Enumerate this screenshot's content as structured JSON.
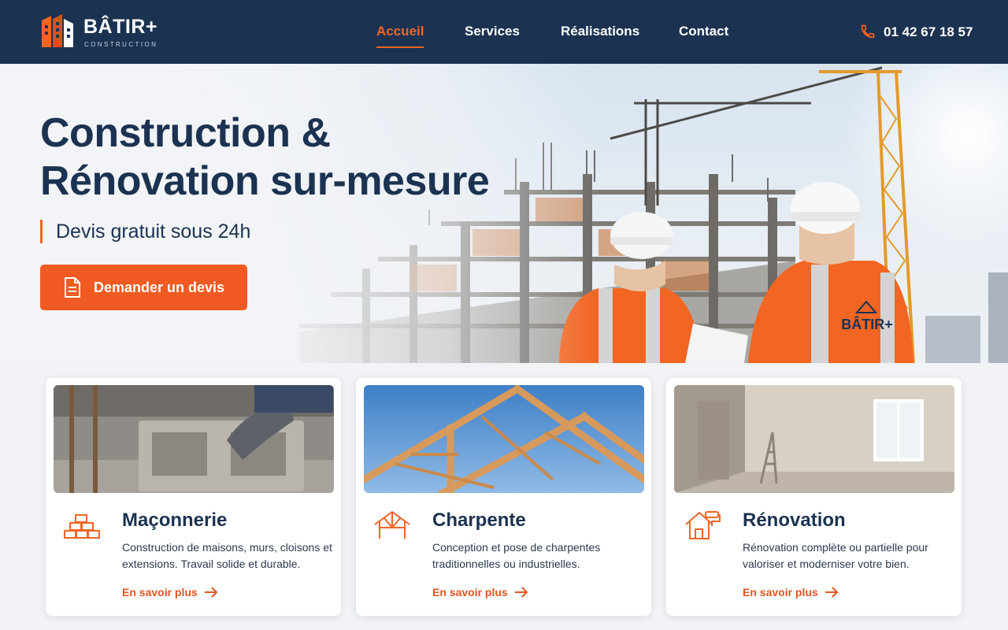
{
  "brand": {
    "name": "BÂTIR+",
    "tagline": "CONSTRUCTION",
    "colors": {
      "primary": "#1b3251",
      "accent": "#f26522"
    }
  },
  "nav": {
    "items": [
      {
        "label": "Accueil",
        "active": true
      },
      {
        "label": "Services",
        "active": false
      },
      {
        "label": "Réalisations",
        "active": false
      },
      {
        "label": "Contact",
        "active": false
      }
    ],
    "phone": {
      "icon": "phone-icon",
      "number": "01 42 67 18 57"
    }
  },
  "hero": {
    "title_line1": "Construction &",
    "title_line2": "Rénovation sur-mesure",
    "subtitle": "Devis gratuit sous 24h",
    "cta": {
      "icon": "document-icon",
      "label": "Demander un devis"
    },
    "vest_logo_text": "BÂTIR+"
  },
  "services": [
    {
      "icon": "bricks-icon",
      "title": "Maçonnerie",
      "description": "Construction de maisons, murs, cloisons et extensions. Travail solide et durable.",
      "link": "En savoir plus"
    },
    {
      "icon": "roof-frame-icon",
      "title": "Charpente",
      "description": "Conception et pose de charpentes traditionnelles ou industrielles.",
      "link": "En savoir plus"
    },
    {
      "icon": "house-roller-icon",
      "title": "Rénovation",
      "description": "Rénovation complète ou partielle pour valoriser et moderniser votre bien.",
      "link": "En savoir plus"
    }
  ]
}
